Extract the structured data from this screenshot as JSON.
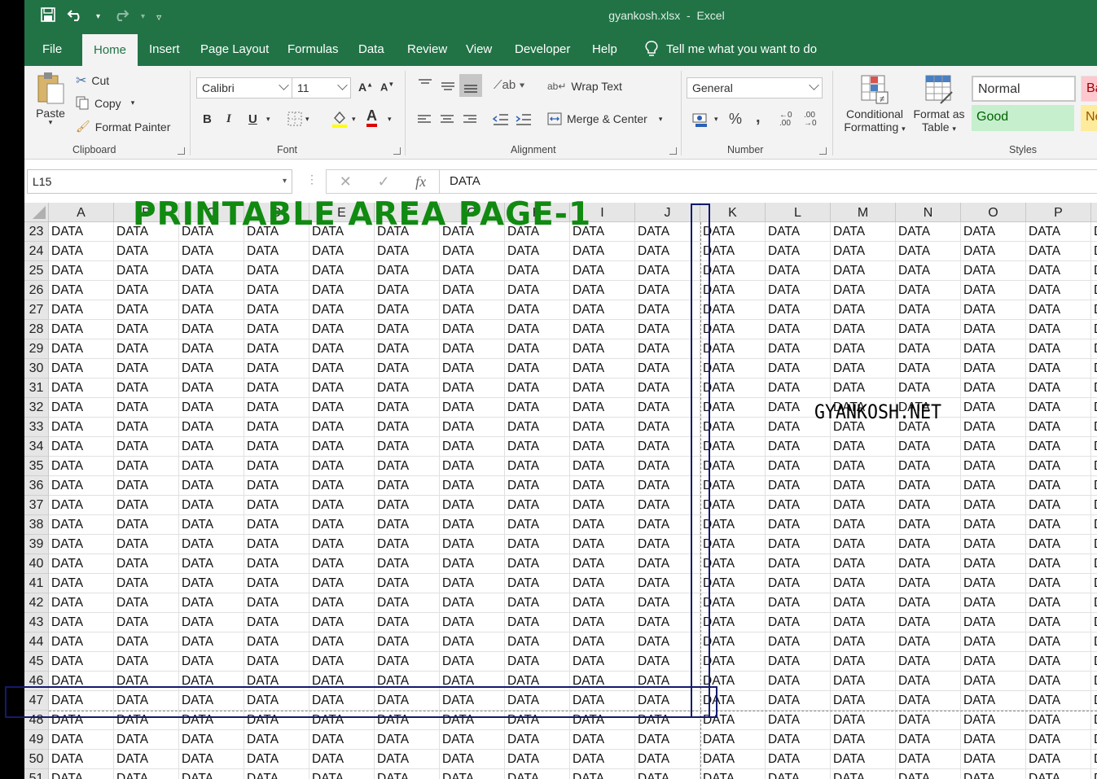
{
  "app": {
    "file_title": "gyankosh.xlsx",
    "app_name": "Excel",
    "title_sep": "-"
  },
  "tabs": [
    "File",
    "Home",
    "Insert",
    "Page Layout",
    "Formulas",
    "Data",
    "Review",
    "View",
    "Developer",
    "Help"
  ],
  "active_tab": "Home",
  "tell_me": "Tell me what you want to do",
  "ribbon": {
    "clipboard": {
      "paste": "Paste",
      "cut": "Cut",
      "copy": "Copy",
      "format_painter": "Format Painter",
      "label": "Clipboard"
    },
    "font": {
      "name": "Calibri",
      "size": "11",
      "bold": "B",
      "italic": "I",
      "underline": "U",
      "label": "Font"
    },
    "alignment": {
      "wrap_text": "Wrap Text",
      "merge_center": "Merge & Center",
      "label": "Alignment"
    },
    "number": {
      "format": "General",
      "percent": "%",
      "comma": ",",
      "label": "Number"
    },
    "styles": {
      "conditional_1": "Conditional",
      "conditional_2": "Formatting",
      "format_as_1": "Format as",
      "format_as_2": "Table",
      "normal": "Normal",
      "good": "Good",
      "bad_partial": "Ba",
      "neutral_partial": "Ne",
      "label": "Styles"
    }
  },
  "formula_bar": {
    "name_box": "L15",
    "fx": "fx",
    "formula": "DATA"
  },
  "sheet": {
    "columns": [
      "A",
      "B",
      "C",
      "D",
      "E",
      "F",
      "G",
      "H",
      "I",
      "J",
      "K",
      "L",
      "M",
      "N",
      "O",
      "P"
    ],
    "rows": [
      "23",
      "24",
      "25",
      "26",
      "27",
      "28",
      "29",
      "30",
      "31",
      "32",
      "33",
      "34",
      "35",
      "36",
      "37",
      "38",
      "39",
      "40",
      "41",
      "42",
      "43",
      "44",
      "45",
      "46",
      "47",
      "48",
      "49",
      "50",
      "51"
    ],
    "cell_value": "DATA"
  },
  "annotations": {
    "printable_area": "PRINTABLE AREA PAGE-1",
    "watermark": "GYANKOSH.NET"
  },
  "colors": {
    "excel_green": "#217346",
    "annotation_green": "#108a10",
    "annotation_box": "#141a6e"
  }
}
